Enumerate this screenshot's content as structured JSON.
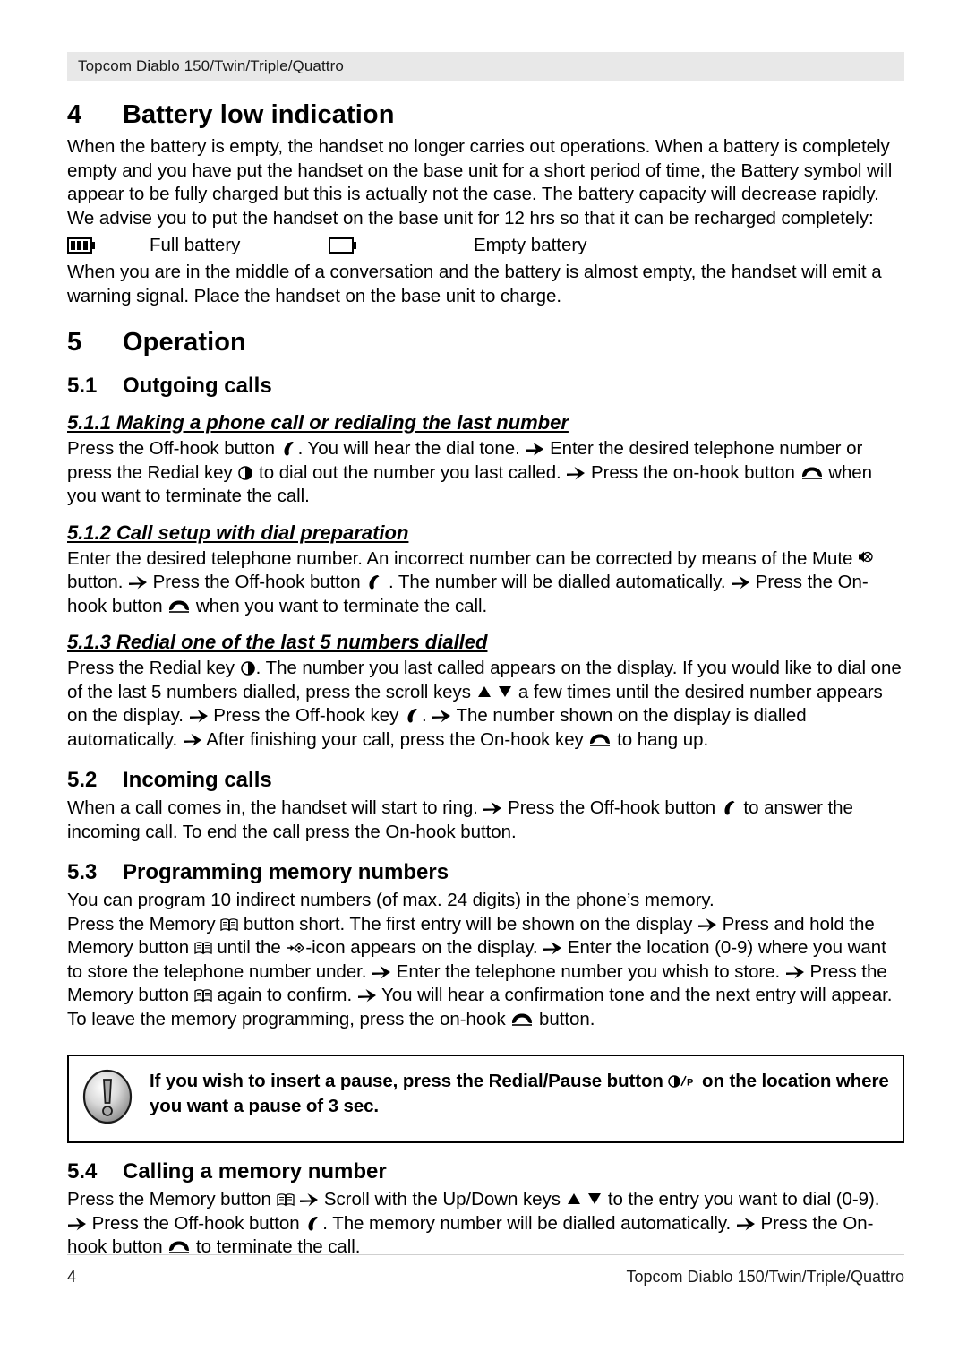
{
  "header": {
    "running_title": "Topcom Diablo 150/Twin/Triple/Quattro"
  },
  "sections": {
    "s4": {
      "number": "4",
      "title": "Battery low indication",
      "paragraph1": "When the battery is empty, the handset no longer carries out operations. When a battery is completely empty and you have put the handset on the base unit for a short period of time, the Battery symbol will appear to be fully charged but this is actually not the case. The battery capacity will decrease rapidly. We advise you to put the handset on the base unit for 12 hrs so that it can be recharged completely:",
      "battery_full_label": "Full battery",
      "battery_empty_label": "Empty battery",
      "paragraph2": "When you are in the middle of a conversation and the battery is almost empty, the handset will emit a warning signal. Place the handset on the base unit to charge."
    },
    "s5": {
      "number": "5",
      "title": "Operation"
    },
    "s51": {
      "number": "5.1",
      "title": "Outgoing calls"
    },
    "s511": {
      "title": "5.1.1 Making a phone call or redialing the last number",
      "t1": "Press the Off-hook button",
      "t2": ". You will hear the dial tone.",
      "t3": "Enter the desired telephone number or press the Redial key",
      "t4": "to dial out the number you last called.",
      "t5": "Press the on-hook button",
      "t6": "when you want to terminate the call."
    },
    "s512": {
      "title": "5.1.2 Call setup with dial preparation",
      "t1": "Enter the desired telephone number. An incorrect number can be corrected by means of the Mute",
      "t2": "button.",
      "t3": "Press the Off-hook button",
      "t4": ". The number will be dialled automatically.",
      "t5": "Press the On-hook button",
      "t6": "when you want to terminate the call."
    },
    "s513": {
      "title": "5.1.3 Redial one of the last 5 numbers dialled",
      "t1": "Press the Redial key",
      "t2": ". The number you last called appears on the display. If you would like to dial one of the last 5 numbers dialled, press the scroll keys",
      "t3": "a few times until the desired number appears on the display.",
      "t4": "Press the Off-hook key",
      "t5": ".",
      "t6": "The number shown on the display is dialled automatically.",
      "t7": "After finishing your call, press the On-hook key",
      "t8": "to hang up."
    },
    "s52": {
      "number": "5.2",
      "title": "Incoming calls",
      "t1": "When a call comes in, the handset will start to ring.",
      "t2": "Press the Off-hook button",
      "t3": "to answer the incoming call. To end the call press  the On-hook button."
    },
    "s53": {
      "number": "5.3",
      "title": "Programming memory numbers",
      "t0": "You can program 10 indirect numbers (of max. 24 digits) in the phone’s memory.",
      "t1": "Press the Memory",
      "t2": "button short.  The first entry will be shown on the display",
      "t3": "Press and hold the Memory button",
      "t4": "until the",
      "t5": "-icon appears on the display.",
      "t6": "Enter the location (0-9) where you want to store the telephone number under.",
      "t7": "Enter the telephone number you whish to store.",
      "t8": "Press the Memory button",
      "t9": "again to confirm.",
      "t10": "You will hear a confirmation tone and the next entry will appear. To leave the memory programming, press the on-hook",
      "t11": "button."
    },
    "note": {
      "t1": "If you wish to insert a pause, press the Redial/Pause button",
      "t2": "on the location where you want a pause of 3 sec."
    },
    "s54": {
      "number": "5.4",
      "title": "Calling a memory number",
      "t1": "Press the Memory button",
      "t2": "Scroll with the Up/Down keys",
      "t3": "to the entry you want to dial (0-9).",
      "t4": "Press the Off-hook button",
      "t5": ". The memory number will be dialled automatically.",
      "t6": "Press the On-hook button",
      "t7": "to terminate the call."
    }
  },
  "footer": {
    "page_number": "4",
    "doc_title": "Topcom Diablo 150/Twin/Triple/Quattro"
  },
  "icons": {
    "arrow": "arrow-right-bold",
    "offhook": "off-hook-handset",
    "onhook": "on-hook-handset",
    "redial": "redial-key",
    "mute": "mute-speaker",
    "memory": "memory-book",
    "scroll_up": "scroll-up-triangle",
    "scroll_down": "scroll-down-triangle",
    "store": "store-arrow-diamond",
    "warning": "warning-exclamation",
    "battery_full": "battery-full",
    "battery_empty": "battery-empty",
    "redial_pause": "redial-pause-key"
  },
  "colors": {
    "header_band": "#e8e8e8",
    "text": "#000000",
    "note_border": "#000000"
  }
}
